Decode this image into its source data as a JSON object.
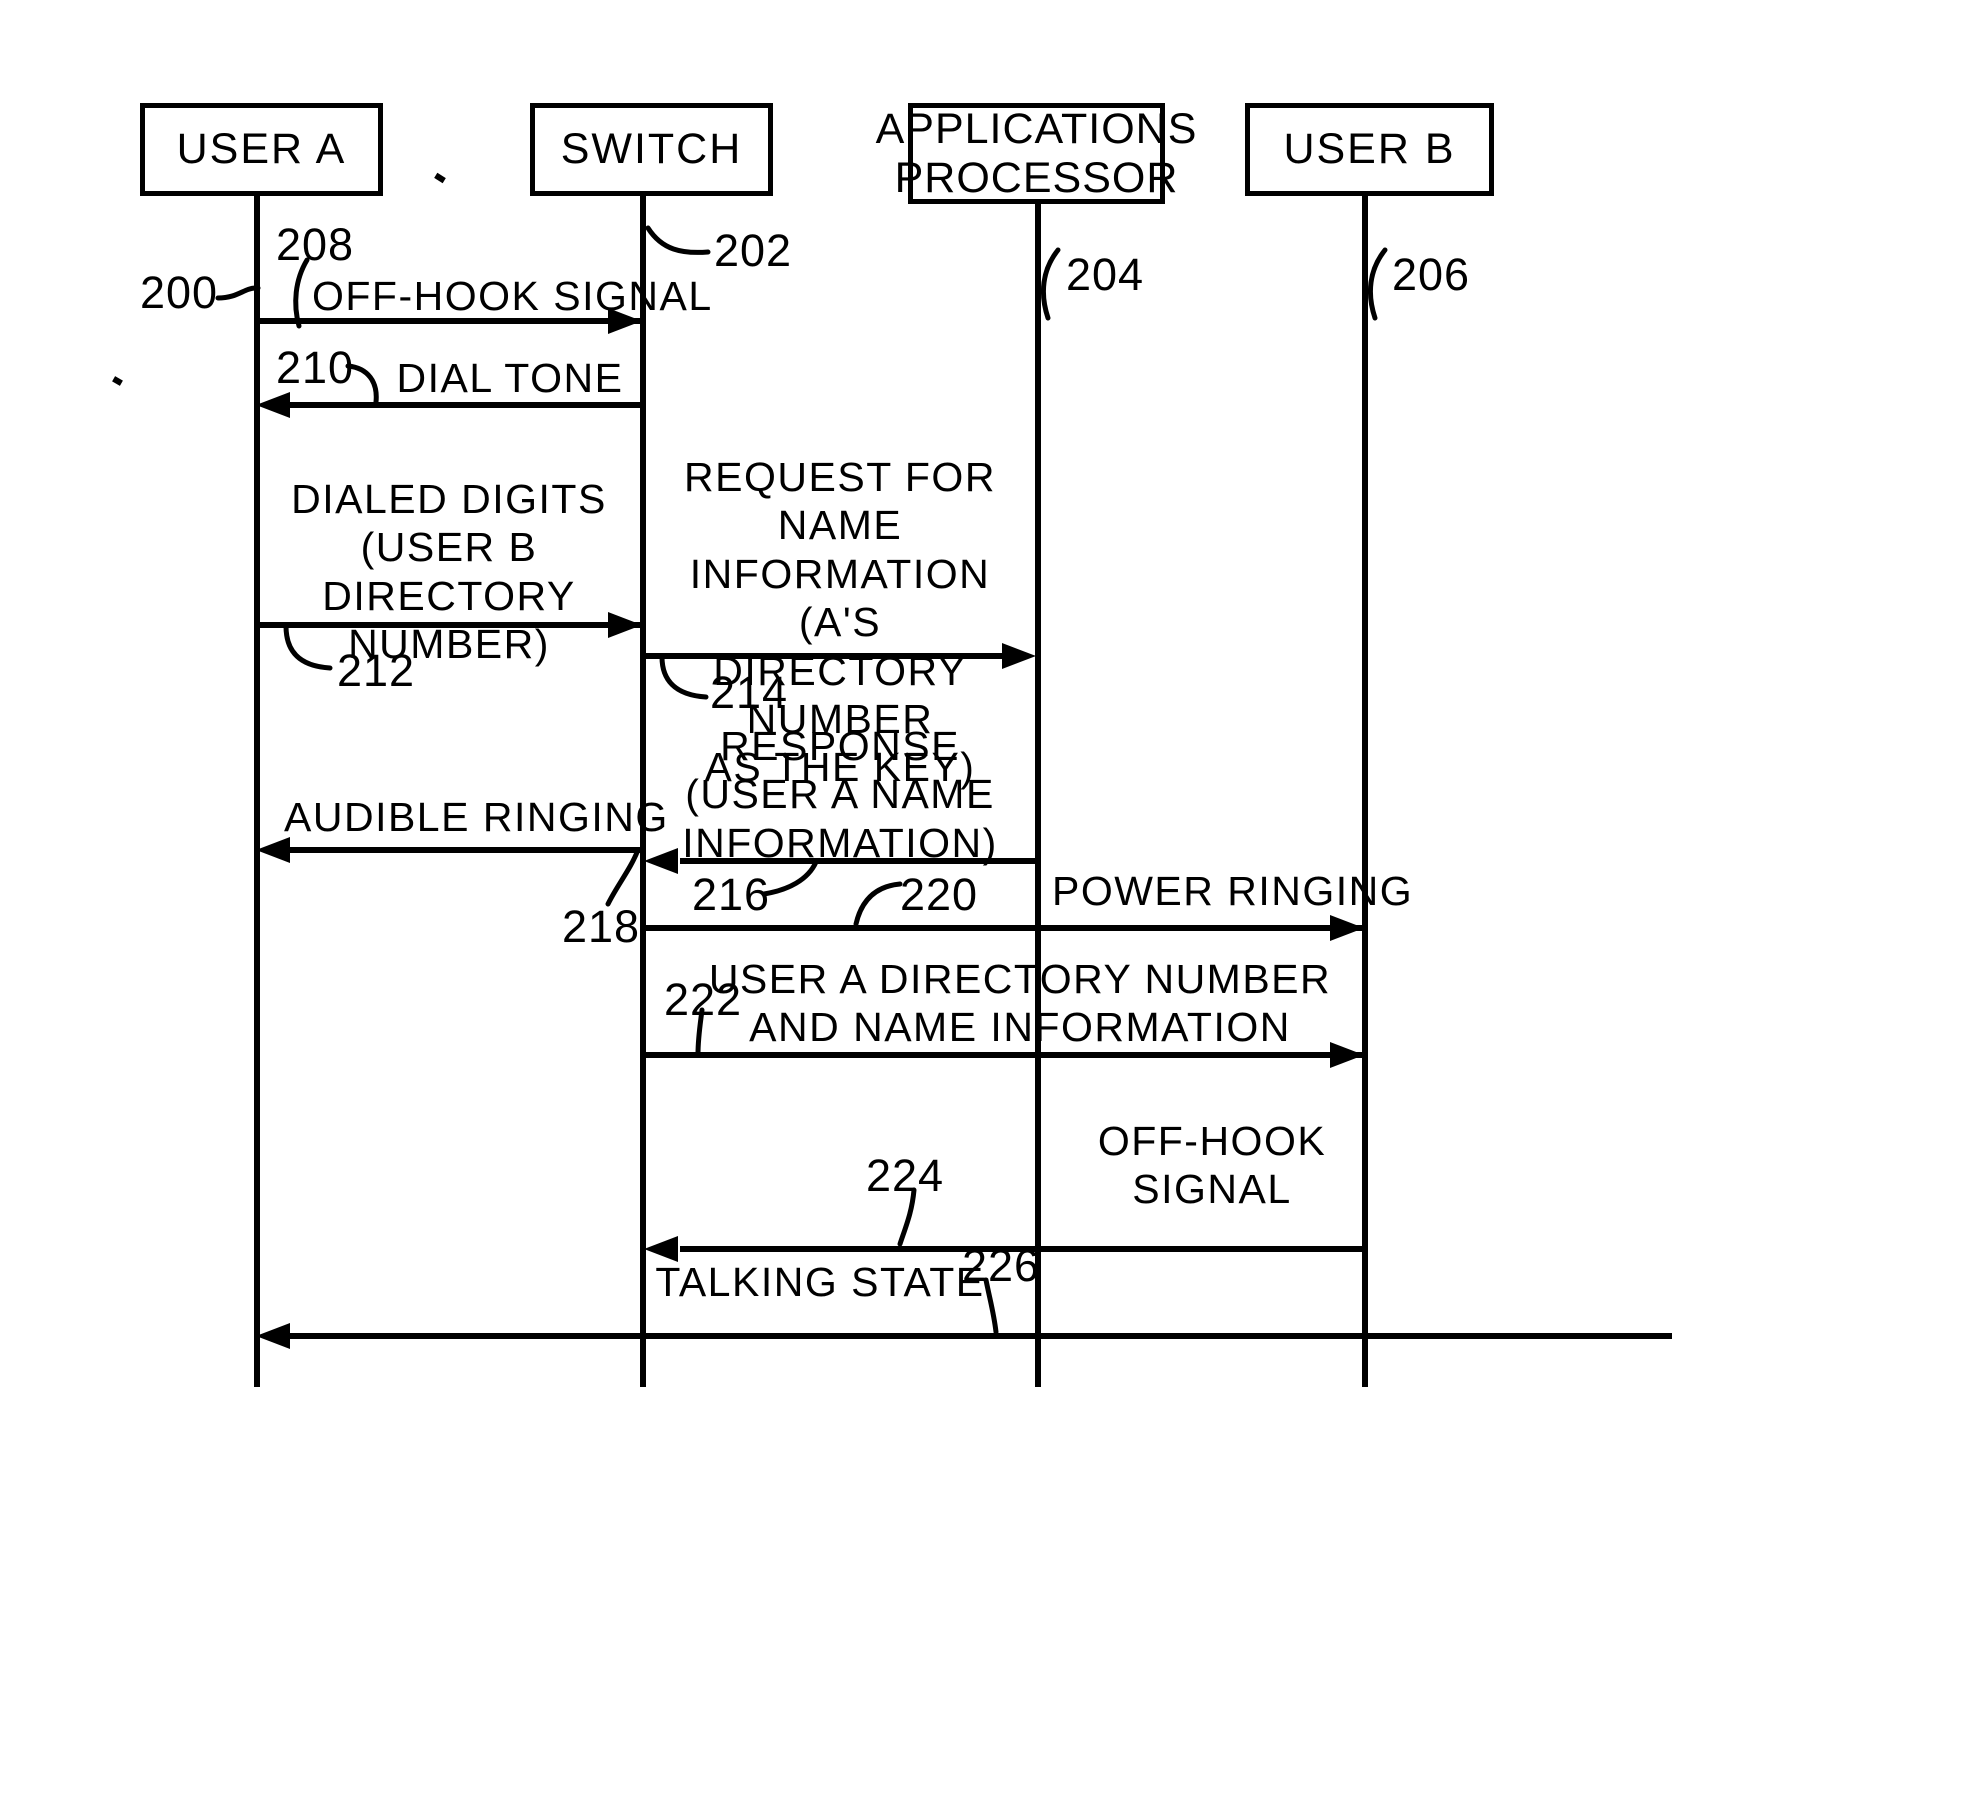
{
  "figure": {
    "type": "call-flow-sequence-diagram",
    "overall_ref": "200"
  },
  "participants": [
    {
      "id": "user_a",
      "label_lines": [
        "USER A"
      ],
      "ref": "208"
    },
    {
      "id": "switch",
      "label_lines": [
        "SWITCH"
      ],
      "ref": "202"
    },
    {
      "id": "applications_processor",
      "label_lines": [
        "APPLICATIONS",
        "PROCESSOR"
      ],
      "ref": "204"
    },
    {
      "id": "user_b",
      "label_lines": [
        "USER B"
      ],
      "ref": "206"
    }
  ],
  "messages": [
    {
      "id": "off_hook_signal",
      "label": "OFF-HOOK SIGNAL",
      "from": "user_a",
      "to": "switch",
      "direction": "right",
      "ref": "208"
    },
    {
      "id": "dial_tone",
      "label": "DIAL TONE",
      "from": "switch",
      "to": "user_a",
      "direction": "left",
      "ref": "210"
    },
    {
      "id": "dialed_digits",
      "label": "DIALED DIGITS\n(USER B DIRECTORY\nNUMBER)",
      "from": "user_a",
      "to": "switch",
      "direction": "right",
      "ref": "212"
    },
    {
      "id": "request_for_name_information",
      "label": "REQUEST FOR NAME\nINFORMATION (A'S\nDIRECTORY NUMBER\nAS THE KEY)",
      "from": "switch",
      "to": "applications_processor",
      "direction": "right",
      "ref": "214"
    },
    {
      "id": "audible_ringing",
      "label": "AUDIBLE RINGING",
      "from": "switch",
      "to": "user_a",
      "direction": "left",
      "ref": "218"
    },
    {
      "id": "response_user_a_name_information",
      "label": "RESPONSE\n(USER A NAME\nINFORMATION)",
      "from": "applications_processor",
      "to": "switch",
      "direction": "left",
      "ref": "216"
    },
    {
      "id": "power_ringing",
      "label": "POWER RINGING",
      "from": "switch",
      "to": "user_b",
      "direction": "right",
      "ref": "220"
    },
    {
      "id": "user_a_directory_number_and_name_information",
      "label": "USER A DIRECTORY NUMBER\nAND NAME INFORMATION",
      "from": "switch",
      "to": "user_b",
      "direction": "right",
      "ref": "222"
    },
    {
      "id": "off_hook_signal_b",
      "label": "OFF-HOOK\nSIGNAL",
      "from": "user_b",
      "to": "switch",
      "direction": "left",
      "ref": "224"
    },
    {
      "id": "talking_state",
      "label": "TALKING STATE",
      "from": "user_b",
      "to": "user_a",
      "direction": "left",
      "ref": "226"
    }
  ],
  "reference_numerals": {
    "overall": "200",
    "switch_lifeline": "202",
    "applications_processor_lifeline": "204",
    "user_b_lifeline": "206",
    "off_hook_signal": "208",
    "dial_tone": "210",
    "dialed_digits": "212",
    "request_for_name_information": "214",
    "response": "216",
    "audible_ringing": "218",
    "power_ringing": "220",
    "user_a_directory_number_and_name_information": "222",
    "off_hook_signal_b": "224",
    "talking_state": "226"
  },
  "colors": {
    "ink": "#000000",
    "paper": "#ffffff"
  }
}
